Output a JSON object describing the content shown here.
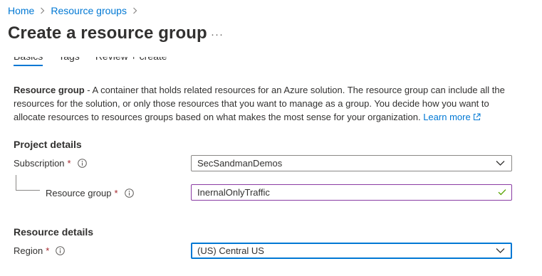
{
  "breadcrumb": {
    "items": [
      {
        "label": "Home"
      },
      {
        "label": "Resource groups"
      }
    ]
  },
  "page": {
    "title": "Create a resource group",
    "more_label": "···"
  },
  "tabs": [
    {
      "label": "Basics",
      "active": true
    },
    {
      "label": "Tags",
      "active": false
    },
    {
      "label": "Review + create",
      "active": false
    }
  ],
  "description": {
    "term": "Resource group",
    "text": " - A container that holds related resources for an Azure solution. The resource group can include all the resources for the solution, or only those resources that you want to manage as a group. You decide how you want to allocate resources to resources groups based on what makes the most sense for your organization. ",
    "link": "Learn more"
  },
  "project_details": {
    "heading": "Project details",
    "subscription": {
      "label": "Subscription",
      "required_mark": "*",
      "value": "SecSandmanDemos"
    },
    "resource_group": {
      "label": "Resource group",
      "required_mark": "*",
      "value": "InernalOnlyTraffic",
      "valid": true
    }
  },
  "resource_details": {
    "heading": "Resource details",
    "region": {
      "label": "Region",
      "required_mark": "*",
      "value": "(US) Central US"
    }
  },
  "colors": {
    "link": "#0078d4",
    "required": "#a4262c",
    "valid_check": "#57a300",
    "focus_border": "#0078d4",
    "textbox_border": "#8a3ca3"
  },
  "icons": {
    "breadcrumb_separator": "chevron-right-icon",
    "info": "info-icon",
    "dropdown": "chevron-down-icon",
    "external_link": "external-link-icon",
    "valid": "checkmark-icon"
  }
}
